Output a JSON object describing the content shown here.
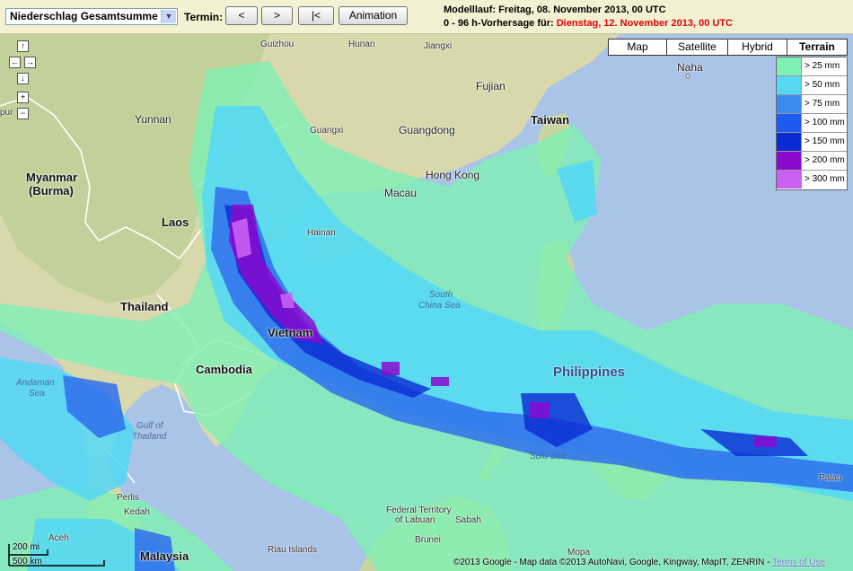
{
  "toolbar": {
    "product_select": "Niederschlag Gesamtsumme",
    "termin_label": "Termin:",
    "btn_prev": "<",
    "btn_next": ">",
    "btn_first": "|<",
    "btn_animation": "Animation",
    "modellauf": "Modelllauf: Freitag, 08. November 2013, 00 UTC",
    "forecast_prefix": "0 - 96 h-Vorhersage für:",
    "forecast_date": "Dienstag, 12. November 2013, 00 UTC"
  },
  "map_types": [
    {
      "label": "Map",
      "active": false
    },
    {
      "label": "Satellite",
      "active": false
    },
    {
      "label": "Hybrid",
      "active": false
    },
    {
      "label": "Terrain",
      "active": true
    }
  ],
  "legend": [
    {
      "label": "> 25 mm",
      "color": "#7ff0b4"
    },
    {
      "label": "> 50 mm",
      "color": "#54d8f6"
    },
    {
      "label": "> 75 mm",
      "color": "#3c8cf0"
    },
    {
      "label": "> 100 mm",
      "color": "#1e5af0"
    },
    {
      "label": "> 150 mm",
      "color": "#0a2ad2"
    },
    {
      "label": "> 200 mm",
      "color": "#8a0ad0"
    },
    {
      "label": "> 300 mm",
      "color": "#c860f4"
    }
  ],
  "places": {
    "guizhou": "Guizhou",
    "hunan": "Hunan",
    "jiangxi": "Jiangxi",
    "fujian": "Fujian",
    "yunnan": "Yunnan",
    "guangxi": "Guangxi",
    "guangdong": "Guangdong",
    "taiwan": "Taiwan",
    "naha": "Naha",
    "hongkong": "Hong Kong",
    "macau": "Macau",
    "myanmar1": "Myanmar",
    "myanmar2": "(Burma)",
    "laos": "Laos",
    "hainan": "Hainan",
    "thailand": "Thailand",
    "south_china_sea1": "South",
    "south_china_sea2": "China Sea",
    "vietnam": "Vietnam",
    "philippines": "Philippines",
    "cambodia": "Cambodia",
    "andaman1": "Andaman",
    "andaman2": "Sea",
    "gulf1": "Gulf of",
    "gulf2": "Thailand",
    "sulu": "Sulu Sea",
    "palau": "Palau",
    "perlis": "Perlis",
    "kedah": "Kedah",
    "labuan1": "Federal Territory",
    "labuan2": "of Labuan",
    "sabah": "Sabah",
    "aceh": "Aceh",
    "brunei": "Brunei",
    "malaysia": "Malaysia",
    "riau": "Riau Islands",
    "mopa": "Mopa",
    "pur": "pur"
  },
  "scale": {
    "miles": "200 mi",
    "km": "500 km"
  },
  "copyright": "©2013 Google - Map data ©2013 AutoNavi, Google, Kingway, MapIT, ZENRIN -",
  "terms": "Terms of Use",
  "nav": {
    "up": "↑",
    "left": "←",
    "right": "→",
    "down": "↓",
    "zoom_in": "+",
    "zoom_out": "−"
  },
  "colors": {
    "sea": "#a9c4e6",
    "land": "#dcdab0",
    "land_green": "#b9cf92",
    "toolbar": "#f4f1d2"
  }
}
